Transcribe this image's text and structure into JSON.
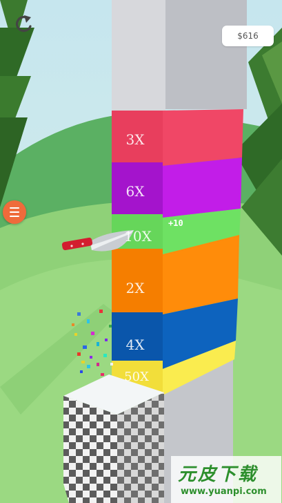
{
  "hud": {
    "money": "$616",
    "undo_icon": "undo-icon",
    "menu_icon": "hamburger-menu-icon"
  },
  "tower": {
    "blocks": [
      {
        "label": "3X",
        "color": "#ef4565"
      },
      {
        "label": "6X",
        "color": "#b81ce3"
      },
      {
        "label": "10X",
        "color": "#6ee05e"
      },
      {
        "label": "2X",
        "color": "#ff8700"
      },
      {
        "label": "4X",
        "color": "#0a5fb8"
      },
      {
        "label": "50X",
        "color": "#f7e744"
      }
    ],
    "plus_label": "+10"
  },
  "watermark": {
    "brand": "元皮下载",
    "url": "www.yuanpi.com"
  }
}
